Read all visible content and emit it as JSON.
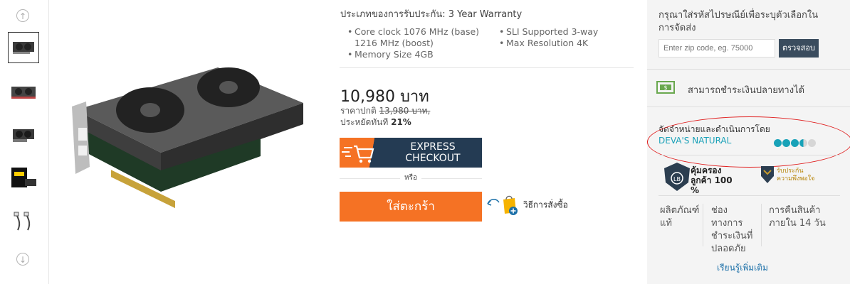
{
  "gallery": {
    "thumbnails": [
      "thumb-1",
      "thumb-2",
      "thumb-3",
      "thumb-4",
      "thumb-5"
    ],
    "selected_index": 0,
    "up_icon": "arrow-up-icon",
    "down_icon": "arrow-down-icon"
  },
  "product": {
    "warranty_label": "ประเภทของการรับประกัน: 3 Year Warranty",
    "specs_left": [
      "Core clock 1076 MHz (base) 1216 MHz (boost)",
      "Memory Size 4GB"
    ],
    "specs_right": [
      "SLI Supported 3-way",
      "Max Resolution 4K"
    ],
    "price": "10,980 บาท",
    "regular_label": "ราคาปกติ",
    "regular_price": "13,980 บาท,",
    "save_label": "ประหยัดทันที",
    "save_value": "21%",
    "express_label": "EXPRESS CHECKOUT",
    "or_label": "หรือ",
    "add_to_cart_label": "ใส่ตะกร้า",
    "how_to_buy_label": "วิธีการสั่งซื้อ"
  },
  "sidebar": {
    "zip_prompt": "กรุณาใส่รหัสไปรษณีย์เพื่อระบุตัวเลือกในการจัดส่ง",
    "zip_placeholder": "Enter zip code, eg. 75000",
    "check_label": "ตรวจสอบ",
    "cod_label": "สามารถชำระเงินปลายทางได้",
    "seller_heading": "จัดจำหน่ายและดำเนินการโดย",
    "seller_name": "DEVA'S NATURAL",
    "seller_rating": 3.5,
    "seller_rating_max": 5,
    "badge1_text": "คุ้มครองลูกค้า 100 %",
    "badge2_line1": "รับประกัน",
    "badge2_line2": "ความพึงพอใจ",
    "guarantee_1": "ผลิตภัณฑ์แท้",
    "guarantee_2": "ช่องทางการชำระเงินที่ปลอดภัย",
    "guarantee_3": "การคืนสินค้าภายใน 14 วัน",
    "learn_more": "เรียนรู้เพิ่มเติม"
  },
  "colors": {
    "accent_orange": "#f57224",
    "navy": "#243b53",
    "teal": "#1aa1b8",
    "star_teal": "#18a2b8",
    "highlight_red": "#e01c1c"
  }
}
